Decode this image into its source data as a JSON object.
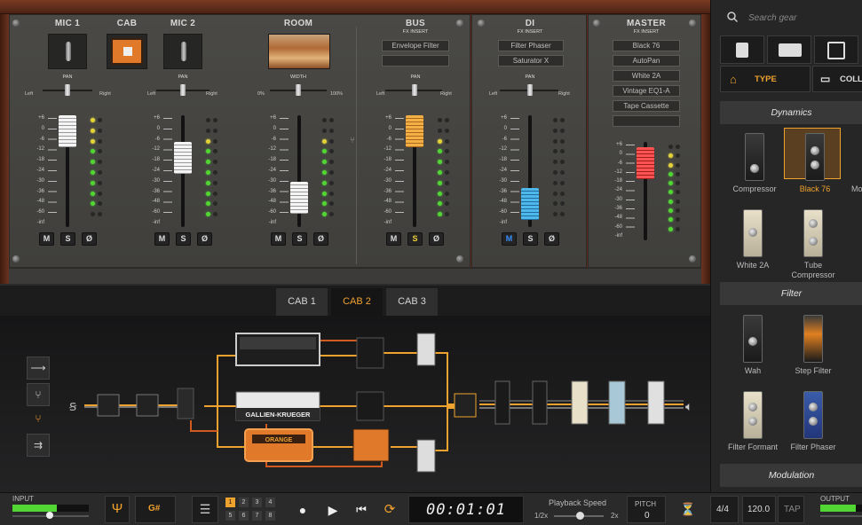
{
  "search": {
    "placeholder": "Search gear"
  },
  "mixer": {
    "mic1": {
      "title": "MIC 1",
      "pan_label": "PAN",
      "left": "Left",
      "right": "Right",
      "level_db": "0"
    },
    "cab": {
      "title": "CAB"
    },
    "mic2": {
      "title": "MIC 2",
      "pan_label": "PAN",
      "left": "Left",
      "right": "Right",
      "level_db": "-16"
    },
    "room": {
      "title": "ROOM",
      "width_label": "WIDTH",
      "min": "0%",
      "max": "100%",
      "level_db": "-40"
    },
    "bus": {
      "title": "BUS",
      "fx_label": "FX INSERT",
      "slots": [
        "Envelope Filter",
        ""
      ],
      "pan_label": "PAN",
      "left": "Left",
      "right": "Right",
      "level_db": "0"
    },
    "di": {
      "title": "DI",
      "fx_label": "FX INSERT",
      "slots": [
        "Filter Phaser",
        "Saturator X"
      ],
      "pan_label": "PAN",
      "left": "Left",
      "right": "Right",
      "level_db": "-48"
    },
    "master": {
      "title": "MASTER",
      "fx_label": "FX INSERT",
      "slots": [
        "Black 76",
        "AutoPan",
        "White 2A",
        "Vintage EQ1-A",
        "Tape Cassette",
        ""
      ],
      "level_db": "-4"
    },
    "scale_full": [
      "+6",
      "0",
      "-6",
      "-12",
      "-18",
      "-24",
      "-30",
      "-36",
      "-48",
      "-60",
      "-inf"
    ],
    "scale_master": [
      "+6",
      "0",
      "-6",
      "-12",
      "-18",
      "-24",
      "-30",
      "-36",
      "-48",
      "-60",
      "-inf"
    ],
    "buttons": {
      "mute": "M",
      "solo": "S",
      "phase": "Ø"
    }
  },
  "cab_tabs": [
    "CAB 1",
    "CAB 2",
    "CAB 3"
  ],
  "cab_brand": {
    "center": "GALLIEN-KRUEGER",
    "orange": "ORANGE"
  },
  "browser": {
    "type_label": "TYPE",
    "collection_label": "COLL",
    "sections": {
      "dynamics": "Dynamics",
      "filter": "Filter",
      "modulation": "Modulation"
    },
    "dynamics_items": [
      "Compressor",
      "Black 76",
      "Mo",
      "White 2A",
      "Tube Compressor"
    ],
    "filter_items": [
      "Wah",
      "Step Filter",
      "Filter Formant",
      "Filter Phaser"
    ]
  },
  "transport": {
    "input_label": "INPUT",
    "output_label": "OUTPUT",
    "tuner_note": "G#",
    "slots": [
      "1",
      "2",
      "3",
      "4",
      "5",
      "6",
      "7",
      "8"
    ],
    "time": "00:01:01",
    "playback_label": "Playback Speed",
    "speed_min": "1/2x",
    "speed_max": "2x",
    "pitch_label": "PITCH",
    "pitch_value": "0",
    "time_sig": "4/4",
    "tempo": "120.0",
    "tap": "TAP"
  },
  "colors": {
    "accent": "#f0a22e",
    "meter_green": "#52d634",
    "meter_yellow": "#e3d23a"
  }
}
